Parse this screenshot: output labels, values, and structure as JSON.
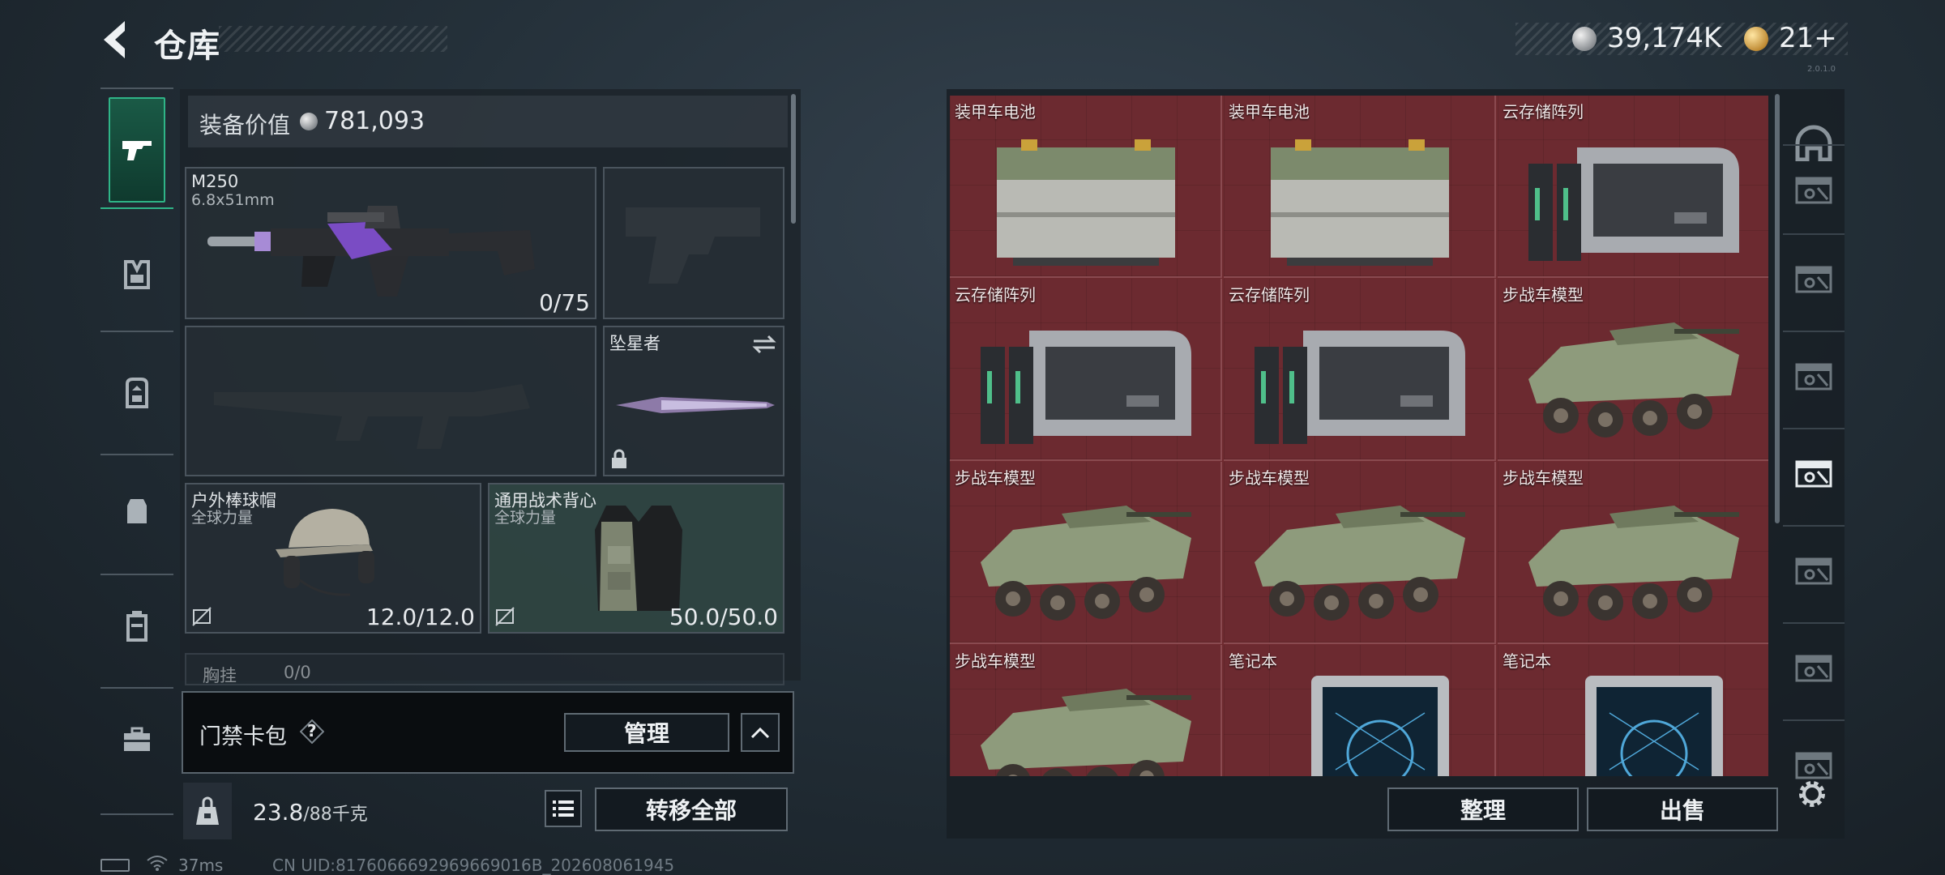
{
  "header": {
    "title": "仓库",
    "silver_amount": "39,174K",
    "gold_amount": "21+",
    "version_tag": "2.0.1.0"
  },
  "loadout": {
    "value_label": "装备价值",
    "value_amount": "781,093",
    "primary_weapon": {
      "name": "M250",
      "caliber": "6.8x51mm",
      "ammo": "0/75"
    },
    "melee": {
      "name": "坠星者"
    },
    "helmet": {
      "name": "户外棒球帽",
      "faction": "全球力量",
      "durability": "12.0/12.0"
    },
    "armor": {
      "name": "通用战术背心",
      "faction": "全球力量",
      "durability": "50.0/50.0"
    },
    "chest_rig": {
      "name": "胸挂",
      "capacity": "0/0"
    }
  },
  "card_pack": {
    "label": "门禁卡包",
    "help": "?",
    "manage_label": "管理"
  },
  "bottom_bar": {
    "weight_value": "23.8",
    "weight_limit": "/88千克",
    "transfer_label": "转移全部"
  },
  "storage": {
    "items": [
      {
        "label": "装甲车电池",
        "icon": "battery"
      },
      {
        "label": "装甲车电池",
        "icon": "battery"
      },
      {
        "label": "云存储阵列",
        "icon": "server"
      },
      {
        "label": "云存储阵列",
        "icon": "server"
      },
      {
        "label": "云存储阵列",
        "icon": "server"
      },
      {
        "label": "步战车模型",
        "icon": "ifv"
      },
      {
        "label": "步战车模型",
        "icon": "ifv"
      },
      {
        "label": "步战车模型",
        "icon": "ifv"
      },
      {
        "label": "步战车模型",
        "icon": "ifv"
      },
      {
        "label": "步战车模型",
        "icon": "ifv"
      },
      {
        "label": "笔记本",
        "icon": "laptop"
      },
      {
        "label": "笔记本",
        "icon": "laptop"
      }
    ],
    "sort_label": "整理",
    "sell_label": "出售"
  },
  "status_bar": {
    "ping": "37ms",
    "uid": "CN UID:8176066692969669016B_202608061945"
  },
  "colors": {
    "accent_green": "#2fb487",
    "storage_bg": "#6c2a30",
    "panel_bg": "#1c232a"
  }
}
